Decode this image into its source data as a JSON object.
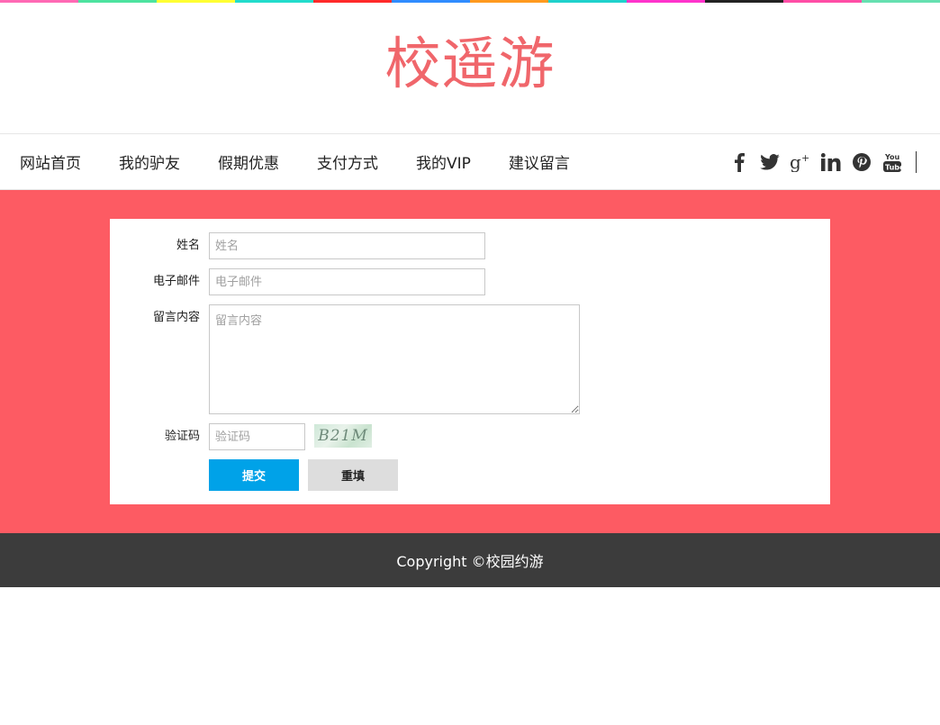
{
  "colors": {
    "strip": [
      "#ff69b4",
      "#4de3a0",
      "#ffff33",
      "#22dccc",
      "#ff2a2a",
      "#2f8cff",
      "#ff9a1f",
      "#1fd1cc",
      "#ff33cc",
      "#222222",
      "#ff4da6",
      "#66e0b0"
    ],
    "logo": "#f0666b",
    "main_bg": "#fd5b63",
    "submit_bg": "#00a2e8",
    "reset_bg": "#dddddd",
    "footer_bg": "#3c3c3c",
    "footer_text": "#ffffff"
  },
  "header": {
    "logo": "校遥游"
  },
  "nav": {
    "links": [
      "网站首页",
      "我的驴友",
      "假期优惠",
      "支付方式",
      "我的VIP",
      "建议留言"
    ],
    "social_icons": [
      "facebook-icon",
      "twitter-icon",
      "google-plus-icon",
      "linkedin-icon",
      "pinterest-icon",
      "youtube-icon"
    ]
  },
  "form": {
    "name": {
      "label": "姓名",
      "placeholder": "姓名"
    },
    "email": {
      "label": "电子邮件",
      "placeholder": "电子邮件"
    },
    "message": {
      "label": "留言内容",
      "placeholder": "留言内容"
    },
    "captcha": {
      "label": "验证码",
      "placeholder": "验证码",
      "code": "B21M"
    },
    "submit_label": "提交",
    "reset_label": "重填"
  },
  "footer": {
    "copyright": "Copyright ©校园约游"
  }
}
